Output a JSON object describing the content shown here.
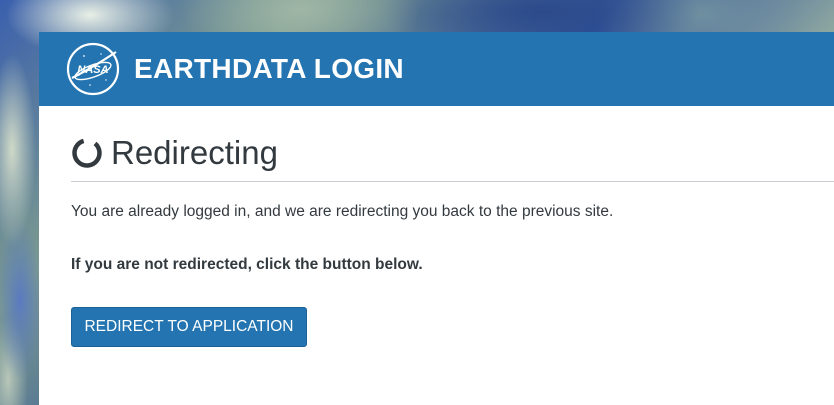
{
  "header": {
    "title": "EARTHDATA LOGIN",
    "logo_icon": "nasa-meatball-logo",
    "logo_text": "NASA",
    "background_color": "#2374b0"
  },
  "main": {
    "heading": "Redirecting",
    "heading_icon": "loading-spinner-icon",
    "message": "You are already logged in, and we are redirecting you back to the previous site.",
    "note": "If you are not redirected, click the button below.",
    "button_label": "REDIRECT TO APPLICATION",
    "button_color": "#2374b0"
  }
}
